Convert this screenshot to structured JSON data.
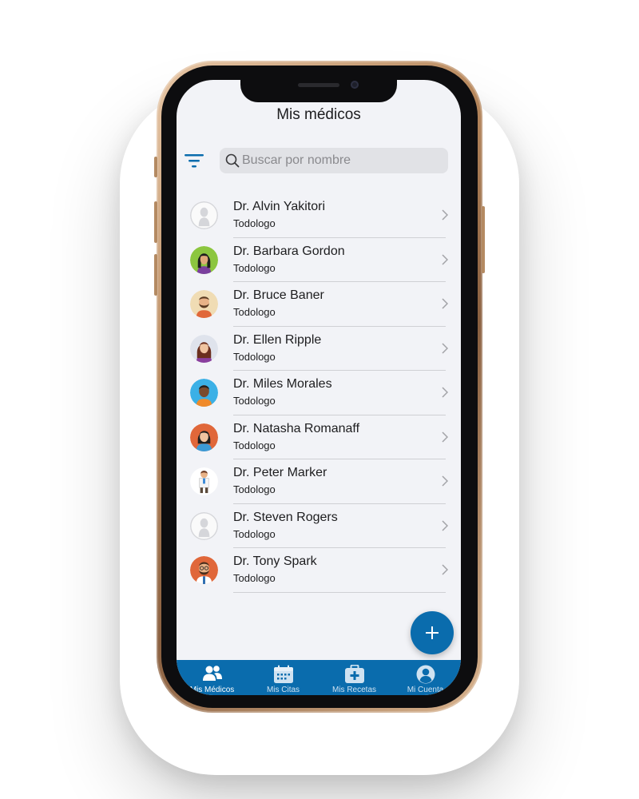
{
  "header": {
    "title": "Mis médicos"
  },
  "search": {
    "placeholder": "Buscar por nombre",
    "value": ""
  },
  "doctors": [
    {
      "name": "Dr. Alvin Yakitori",
      "specialty": "Todologo",
      "avatar": "placeholder"
    },
    {
      "name": "Dr. Barbara Gordon",
      "specialty": "Todologo",
      "avatar": "woman-green"
    },
    {
      "name": "Dr. Bruce Baner",
      "specialty": "Todologo",
      "avatar": "man-beard-beige"
    },
    {
      "name": "Dr. Ellen Ripple",
      "specialty": "Todologo",
      "avatar": "woman-brown"
    },
    {
      "name": "Dr. Miles Morales",
      "specialty": "Todologo",
      "avatar": "man-blue"
    },
    {
      "name": "Dr. Natasha Romanaff",
      "specialty": "Todologo",
      "avatar": "woman-orange"
    },
    {
      "name": "Dr. Peter Marker",
      "specialty": "Todologo",
      "avatar": "doctor-figure"
    },
    {
      "name": "Dr. Steven Rogers",
      "specialty": "Todologo",
      "avatar": "placeholder"
    },
    {
      "name": "Dr. Tony Spark",
      "specialty": "Todologo",
      "avatar": "man-glasses-orange"
    }
  ],
  "fab": {
    "icon": "plus-icon"
  },
  "tabs": [
    {
      "label": "Mis Médicos",
      "icon": "doctors-icon",
      "active": true
    },
    {
      "label": "Mis Citas",
      "icon": "calendar-icon",
      "active": false
    },
    {
      "label": "Mis Recetas",
      "icon": "prescription-icon",
      "active": false
    },
    {
      "label": "Mi Cuenta",
      "icon": "account-icon",
      "active": false
    }
  ],
  "colors": {
    "primary": "#0a6cad",
    "background": "#f2f3f7",
    "search_bg": "#e1e2e6",
    "frame": "#b8895e"
  }
}
